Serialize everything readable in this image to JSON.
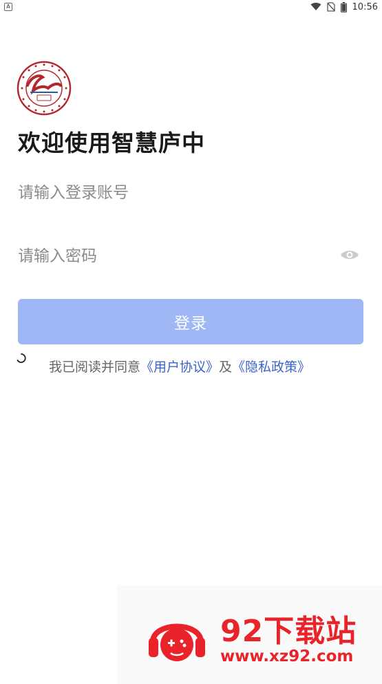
{
  "status_bar": {
    "notification_badge": "A",
    "time": "10:56"
  },
  "app": {
    "title": "欢迎使用智慧庐中"
  },
  "login_form": {
    "account_placeholder": "请输入登录账号",
    "password_placeholder": "请输入密码",
    "login_label": "登录"
  },
  "agreement": {
    "prefix": "我已阅读并同意",
    "user_agreement_link": "《用户协议》",
    "conjunction": "及",
    "privacy_policy_link": "《隐私政策》"
  },
  "watermark": {
    "title": "92下载站",
    "url": "www.xz92.com"
  },
  "colors": {
    "primary_button": "#9fb7f5",
    "link": "#3b63c9",
    "watermark_red": "#e8242a",
    "logo_red": "#b3282d"
  },
  "icons": {
    "wifi": "wifi-icon",
    "sim": "no-sim-icon",
    "battery": "battery-icon",
    "eye": "eye-icon",
    "check": "agreement-checkbox-icon"
  }
}
